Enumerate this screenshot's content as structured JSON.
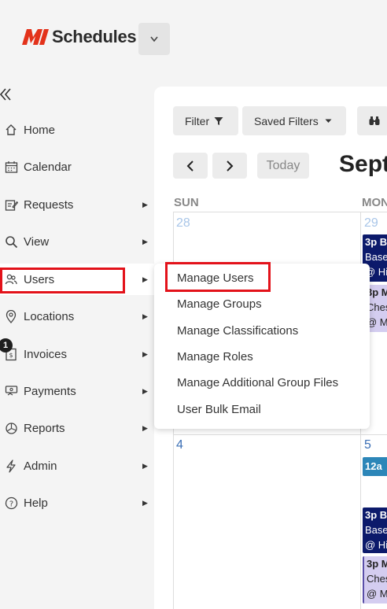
{
  "header": {
    "app_name": "Schedules"
  },
  "sidebar": {
    "items": [
      {
        "label": "Home"
      },
      {
        "label": "Calendar"
      },
      {
        "label": "Requests"
      },
      {
        "label": "View"
      },
      {
        "label": "Users"
      },
      {
        "label": "Locations"
      },
      {
        "label": "Invoices",
        "badge": "1"
      },
      {
        "label": "Payments"
      },
      {
        "label": "Reports"
      },
      {
        "label": "Admin"
      },
      {
        "label": "Help"
      }
    ]
  },
  "toolbar": {
    "filter_label": "Filter",
    "saved_filters_label": "Saved Filters"
  },
  "calendar": {
    "today_label": "Today",
    "month_title": "Sept",
    "days_of_week": [
      "SUN",
      "MON"
    ],
    "week1": {
      "sun": "28",
      "mon": "29"
    },
    "week2": {
      "sun": "4",
      "mon": "5"
    },
    "events": [
      {
        "time": "3p B",
        "line2": "Base",
        "line3": "@ Hi"
      },
      {
        "time": "3p M",
        "line2": "Ches",
        "line3": "@ M"
      },
      {
        "time": "12a"
      },
      {
        "time": "3p B",
        "line2": "Base",
        "line3": "@ Hi"
      },
      {
        "time": "3p M",
        "line2": "Ches",
        "line3": "@ M"
      }
    ]
  },
  "users_menu": {
    "items": [
      "Manage Users",
      "Manage Groups",
      "Manage Classifications",
      "Manage Roles",
      "Manage Additional Group Files",
      "User Bulk Email"
    ]
  },
  "colors": {
    "brand_red": "#e3321a",
    "highlight_red": "#e3121a",
    "event_navy": "#0c1a6b",
    "event_lavender": "#d4cdf0",
    "event_teal": "#2c86b8"
  }
}
